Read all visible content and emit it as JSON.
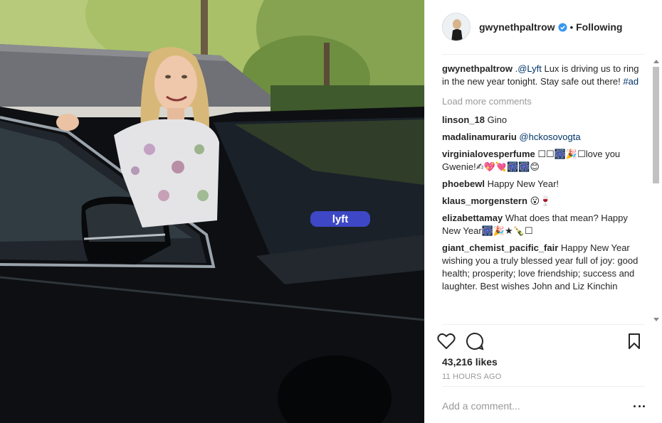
{
  "post": {
    "username": "gwynethpaltrow",
    "separator": "•",
    "follow_status": "Following",
    "caption_user": "gwynethpaltrow",
    "caption_mention": ".@Lyft",
    "caption_text": " Lux is driving us to ring in the new year tonight. Stay safe out there! ",
    "caption_hashtag": "#ad",
    "load_more": "Load more comments",
    "likes": "43,216 likes",
    "timestamp": "11 HOURS AGO",
    "add_comment_placeholder": "Add a comment...",
    "photo_badge": "lyft"
  },
  "comments": [
    {
      "user": "linson_18",
      "text": "Gino"
    },
    {
      "user": "madalinamurariu",
      "text": "@hckosovogta"
    },
    {
      "user": "virginialovesperfume",
      "text": "☐☐🎆🎉☐love you Gwenie!✍💖💘🎆🎆😊"
    },
    {
      "user": "phoebewl",
      "text": "Happy New Year!"
    },
    {
      "user": "klaus_morgenstern",
      "text": "😮🍷"
    },
    {
      "user": "elizabettamay",
      "text": "What does that mean? Happy New Year🎆🎉★🍾☐"
    },
    {
      "user": "giant_chemist_pacific_fair",
      "text": "Happy New Year wishing you a truly blessed year full of joy: good health; prosperity; love friendship; success and laughter. Best wishes John and Liz Kinchin"
    }
  ],
  "icons": {
    "heart": "heart-icon",
    "comment": "comment-icon",
    "save": "bookmark-icon",
    "verified": "verified-badge-icon",
    "more": "more-options-icon"
  },
  "colors": {
    "link": "#003569",
    "muted": "#999999",
    "verified": "#3897f0",
    "text": "#262626",
    "lyft_badge": "#3e47c6"
  }
}
